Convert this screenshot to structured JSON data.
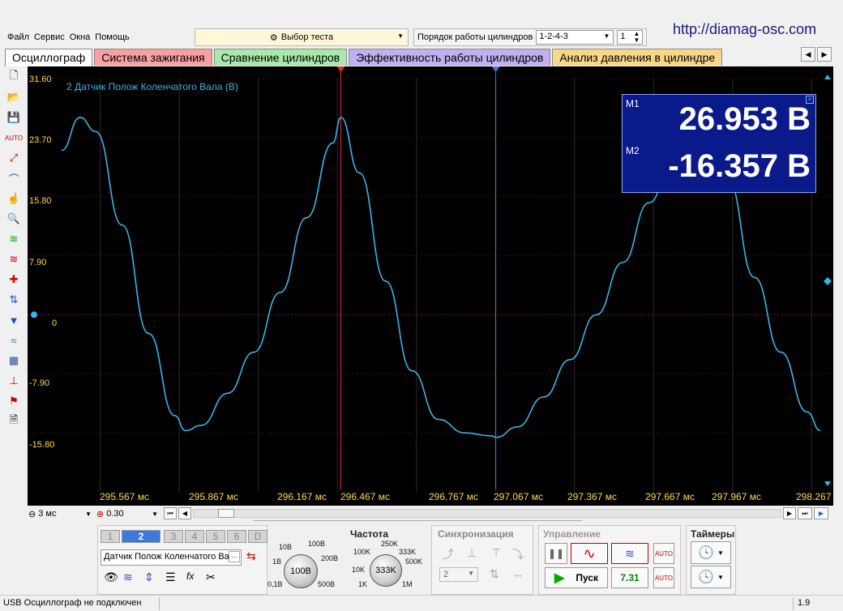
{
  "site_url": "http://diamag-osc.com",
  "menu": [
    "Файл",
    "Сервис",
    "Окна",
    "Помощь"
  ],
  "test_select": {
    "label": "Выбор теста"
  },
  "cyl_order": {
    "label": "Порядок работы цилиндров",
    "value": "1-2-4-3",
    "spin": "1"
  },
  "tabs": [
    {
      "label": "Осциллограф",
      "color": "#ffffff"
    },
    {
      "label": "Система зажигания",
      "color": "#f8a0a0"
    },
    {
      "label": "Сравнение цилиндров",
      "color": "#a8e8a8"
    },
    {
      "label": "Эффективность работы цилиндров",
      "color": "#c0b0f0"
    },
    {
      "label": "Анализ давления в цилиндре",
      "color": "#f8d888"
    }
  ],
  "toolbar_icons": [
    "new-file-icon",
    "open-folder-icon",
    "save-icon",
    "auto-icon",
    "cursor-icon",
    "hand-icon",
    "zoom-icon",
    "waves-icon",
    "waves2-icon",
    "add-channel-icon",
    "marker-icon",
    "filter-icon",
    "channel-icon",
    "table-icon",
    "zero-icon",
    "flag-icon",
    "note-icon"
  ],
  "scope": {
    "channel_label": "2 Датчик Полож Коленчатого Вала (В)",
    "y_ticks": [
      "31.60",
      "23.70",
      "15.80",
      "7.90",
      "0",
      "-7.90",
      "-15.80"
    ],
    "x_ticks": [
      "295.567 мс",
      "295.867 мс",
      "296.167 мс",
      "296.467 мс",
      "296.767 мс",
      "297.067 мс",
      "297.367 мс",
      "297.667 мс",
      "297.967 мс",
      "298.267"
    ],
    "marker1_label": "1",
    "marker2_label": "2"
  },
  "chart_data": {
    "type": "line",
    "xlabel": "",
    "ylabel": "",
    "ylim": [
      -23.7,
      31.6
    ],
    "x_unit": "мс",
    "series": [
      {
        "name": "2 Датчик Полож Коленчатого Вала (В)",
        "x": [
          295.42,
          295.49,
          295.55,
          295.65,
          295.75,
          295.85,
          295.89,
          295.95,
          296.05,
          296.15,
          296.25,
          296.35,
          296.45,
          296.48,
          296.55,
          296.65,
          296.75,
          296.85,
          296.95,
          297.05,
          297.07,
          297.15,
          297.25,
          297.35,
          297.45,
          297.55,
          297.65,
          297.75,
          297.85,
          297.95,
          298.05,
          298.15,
          298.25,
          298.3
        ],
        "values": [
          22.0,
          26.4,
          24.5,
          12.0,
          -2.5,
          -13.5,
          -15.5,
          -14.8,
          -10.5,
          -5.0,
          3.0,
          13.0,
          23.0,
          26.4,
          19.0,
          4.5,
          -7.5,
          -14.0,
          -15.8,
          -16.2,
          -16.4,
          -15.0,
          -11.0,
          -6.0,
          0.0,
          7.0,
          15.0,
          22.0,
          26.5,
          18.0,
          5.0,
          -5.0,
          -13.0,
          -15.5
        ]
      }
    ],
    "markers": [
      {
        "x": 296.48,
        "label": "M1",
        "value": 26.953
      },
      {
        "x": 297.068,
        "label": "M2",
        "value": -16.357
      }
    ]
  },
  "measurement": {
    "m1_label": "M1",
    "m1_value": "26.953 В",
    "m2_label": "M2",
    "m2_value": "-16.357 В"
  },
  "timebase": {
    "value": "3 мс"
  },
  "zoom": {
    "value": "0.30"
  },
  "channels": [
    "1",
    "2",
    "3",
    "4",
    "5",
    "6",
    "D"
  ],
  "channel_name": "Датчик Полож Коленчатого Ва",
  "voltage_knob": {
    "center": "100В",
    "ticks": [
      "10В",
      "100В",
      "1В",
      "200В",
      "0,1В",
      "500В"
    ]
  },
  "frequency": {
    "title": "Частота",
    "center": "333K",
    "ticks": [
      "250K",
      "100K",
      "333K",
      "10K",
      "500K",
      "1K",
      "1M"
    ]
  },
  "sync": {
    "title": "Синхронизация",
    "value": "2"
  },
  "control": {
    "title": "Управление",
    "start_label": "Пуск",
    "value": "7.31"
  },
  "timers": {
    "title": "Таймеры"
  },
  "status": {
    "left": "USB Осциллограф не подключен",
    "right": "1.9"
  }
}
